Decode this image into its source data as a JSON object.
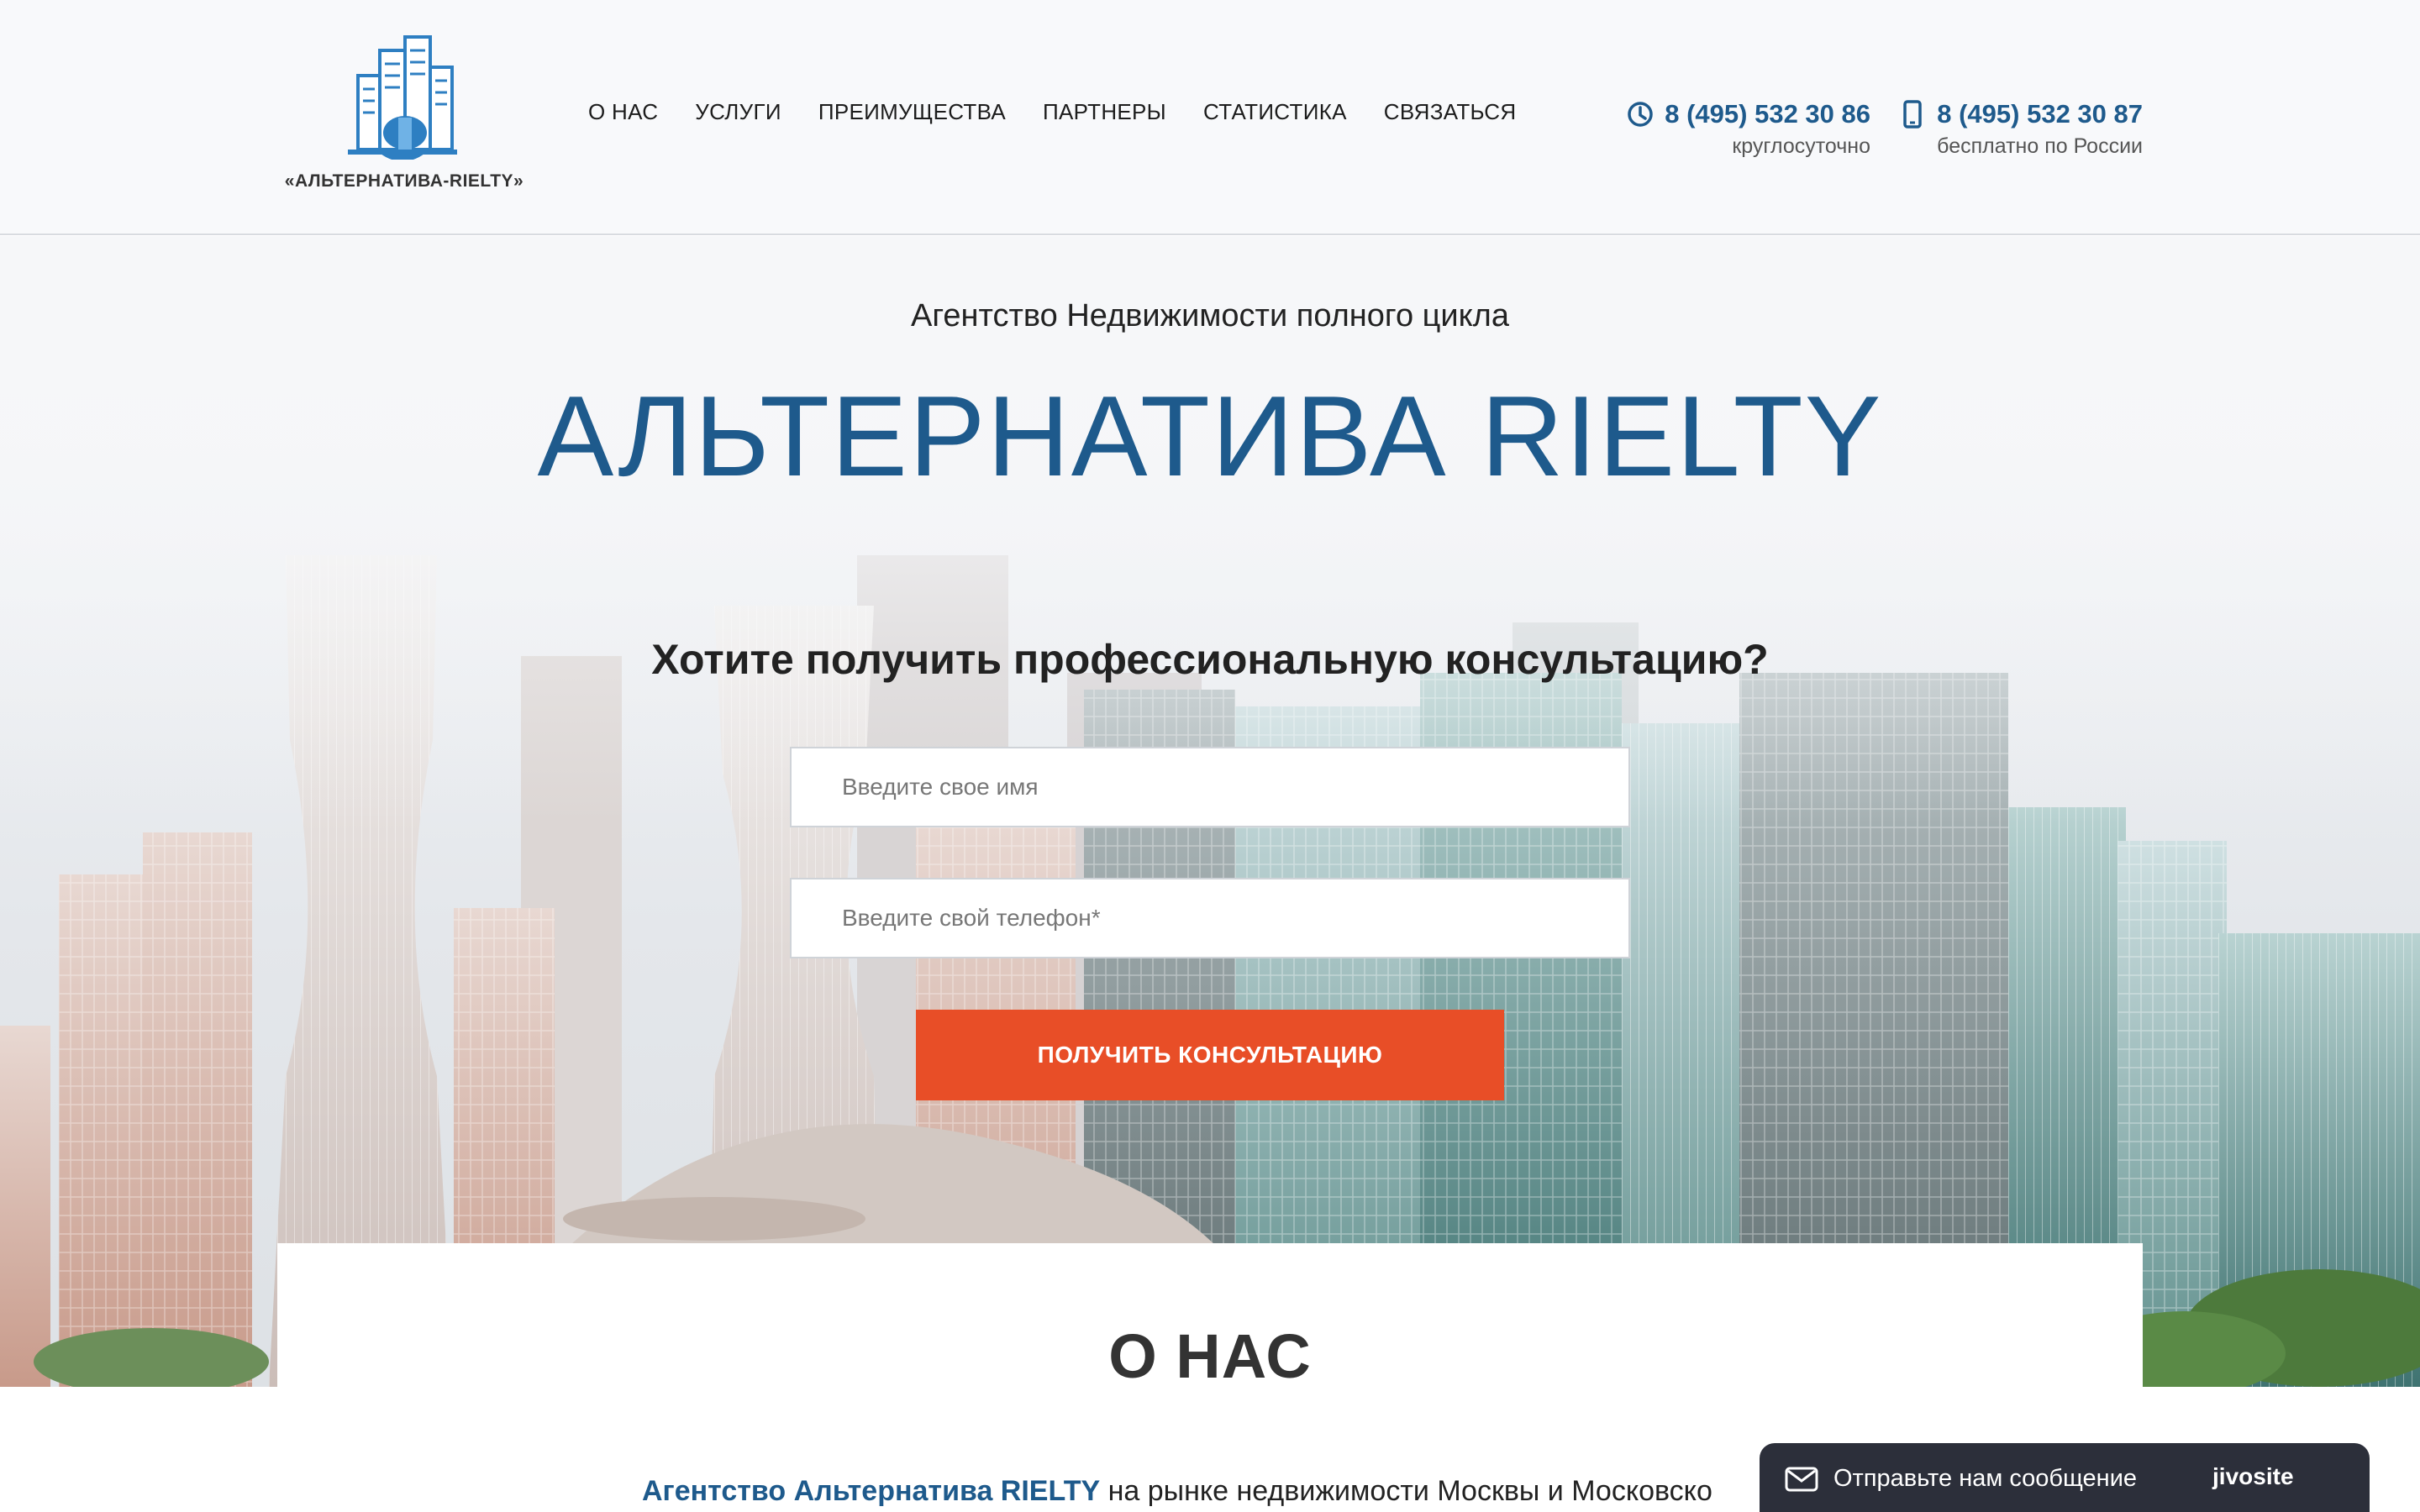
{
  "header": {
    "logo_text": "«АЛЬТЕРНАТИВА-RIELTY»",
    "nav": [
      {
        "label": "О НАС"
      },
      {
        "label": "УСЛУГИ"
      },
      {
        "label": "ПРЕИМУЩЕСТВА"
      },
      {
        "label": "ПАРТНЕРЫ"
      },
      {
        "label": "СТАТИСТИКА"
      },
      {
        "label": "СВЯЗАТЬСЯ"
      }
    ],
    "phones": [
      {
        "icon": "clock-icon",
        "number": "8 (495) 532 30 86",
        "note": "круглосуточно"
      },
      {
        "icon": "mobile-phone-icon",
        "number": "8 (495) 532 30 87",
        "note": "бесплатно по России"
      }
    ]
  },
  "hero": {
    "subtitle": "Агентство Недвижимости полного цикла",
    "title": "АЛЬТЕРНАТИВА RIELTY",
    "question": "Хотите получить профессиональную консультацию?",
    "name_placeholder": "Введите свое имя",
    "phone_placeholder": "Введите свой телефон*",
    "cta_label": "ПОЛУЧИТЬ КОНСУЛЬТАЦИЮ"
  },
  "about": {
    "title": "О НАС",
    "text_brand": "Агентство Альтернатива RIELTY",
    "text_rest": " на рынке недвижимости Москвы и Московско"
  },
  "chat": {
    "label": "Отправьте нам сообщение",
    "brand": "jivosite"
  },
  "colors": {
    "brand_blue": "#1e5a8c",
    "cta_orange": "#e84e27",
    "chat_bg": "#2c2f3a"
  }
}
